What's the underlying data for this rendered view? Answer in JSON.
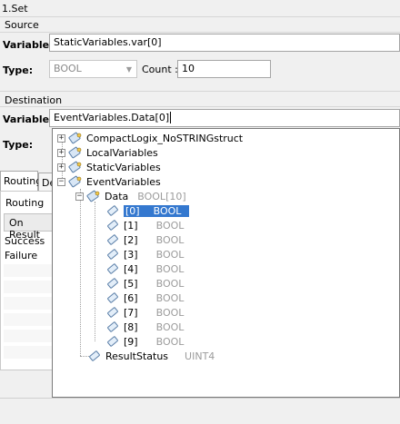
{
  "window": {
    "title": "1.Set"
  },
  "source": {
    "group_label": "Source",
    "variable_label": "Variable:",
    "variable_value": "StaticVariables.var[0]",
    "type_label": "Type:",
    "type_value": "BOOL",
    "count_label": "Count :",
    "count_value": "10"
  },
  "destination": {
    "group_label": "Destination",
    "variable_label": "Variable:",
    "variable_value": "EventVariables.Data[0]",
    "type_label": "Type:"
  },
  "tabs": [
    {
      "label": "Routing"
    },
    {
      "label": "De"
    }
  ],
  "routing_panel": {
    "header": "Routing",
    "on_result_button": "On Result",
    "rows": [
      "Success",
      "Failure"
    ]
  },
  "tree": {
    "roots": [
      {
        "label": "CompactLogix_NoSTRINGstruct",
        "expanded": false
      },
      {
        "label": "LocalVariables",
        "expanded": false
      },
      {
        "label": "StaticVariables",
        "expanded": false
      },
      {
        "label": "EventVariables",
        "expanded": true
      }
    ],
    "data_node": {
      "label": "Data",
      "type": "BOOL[10]"
    },
    "elements": [
      {
        "index": "[0]",
        "type": "BOOL",
        "selected": true
      },
      {
        "index": "[1]",
        "type": "BOOL"
      },
      {
        "index": "[2]",
        "type": "BOOL"
      },
      {
        "index": "[3]",
        "type": "BOOL"
      },
      {
        "index": "[4]",
        "type": "BOOL"
      },
      {
        "index": "[5]",
        "type": "BOOL"
      },
      {
        "index": "[6]",
        "type": "BOOL"
      },
      {
        "index": "[7]",
        "type": "BOOL"
      },
      {
        "index": "[8]",
        "type": "BOOL"
      },
      {
        "index": "[9]",
        "type": "BOOL"
      }
    ],
    "result_status": {
      "label": "ResultStatus",
      "type": "UINT4"
    }
  },
  "colors": {
    "selection": "#3478cf",
    "type_text": "#9b9b9b"
  }
}
